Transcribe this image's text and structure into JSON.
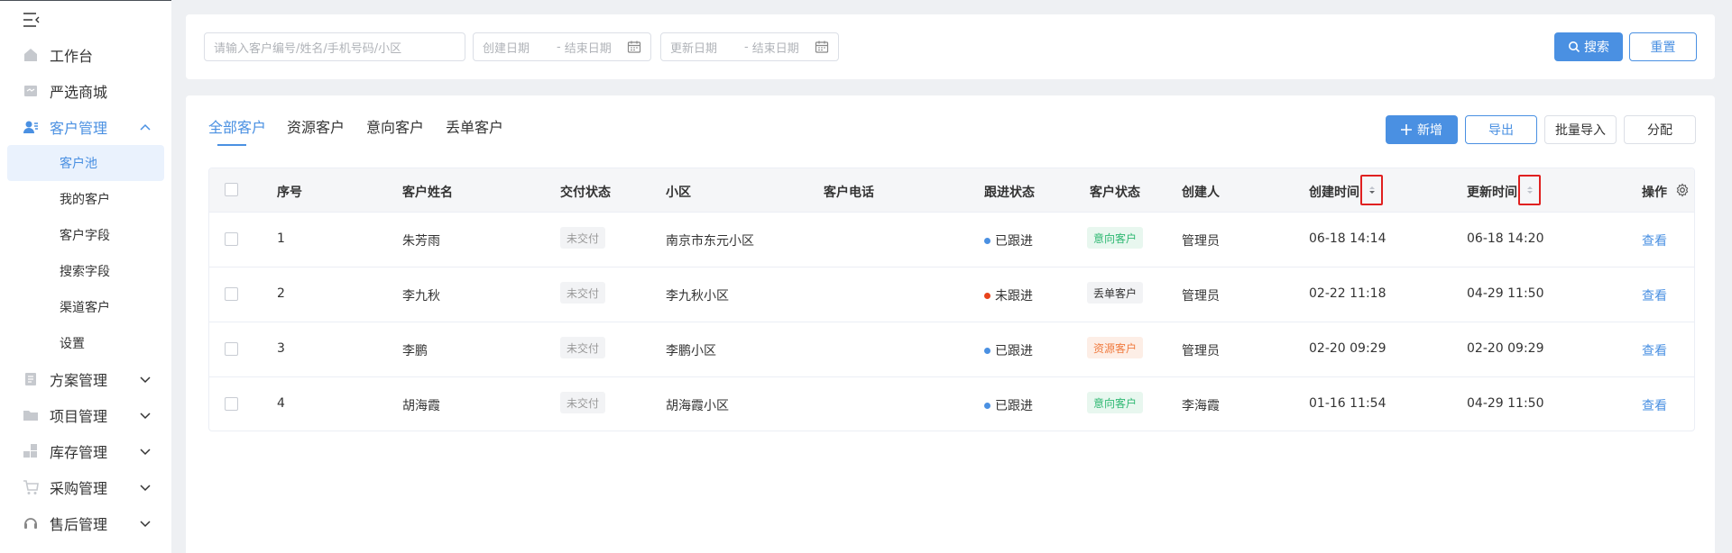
{
  "sidebar": {
    "items": [
      {
        "label": "工作台",
        "icon": "home-icon"
      },
      {
        "label": "严选商城",
        "icon": "shop-icon"
      },
      {
        "label": "客户管理",
        "icon": "user-icon",
        "expanded": true
      },
      {
        "label": "方案管理",
        "icon": "document-icon"
      },
      {
        "label": "项目管理",
        "icon": "folder-icon"
      },
      {
        "label": "库存管理",
        "icon": "blocks-icon"
      },
      {
        "label": "采购管理",
        "icon": "cart-icon"
      },
      {
        "label": "售后管理",
        "icon": "headset-icon"
      }
    ],
    "sub_items": [
      {
        "label": "客户池",
        "active": true
      },
      {
        "label": "我的客户"
      },
      {
        "label": "客户字段"
      },
      {
        "label": "搜索字段"
      },
      {
        "label": "渠道客户"
      },
      {
        "label": "设置"
      }
    ]
  },
  "filters": {
    "search_placeholder": "请输入客户编号/姓名/手机号码/小区",
    "created": {
      "start": "创建日期",
      "sep": "-",
      "end": "结束日期"
    },
    "updated": {
      "start": "更新日期",
      "sep": "-",
      "end": "结束日期"
    },
    "search_label": "搜索",
    "reset_label": "重置"
  },
  "tabs": [
    "全部客户",
    "资源客户",
    "意向客户",
    "丢单客户"
  ],
  "actions": {
    "add_label": "新增",
    "export_label": "导出",
    "import_label": "批量导入",
    "assign_label": "分配"
  },
  "table": {
    "headers": {
      "index": "序号",
      "name": "客户姓名",
      "delivery": "交付状态",
      "community": "小区",
      "phone": "客户电话",
      "follow": "跟进状态",
      "status": "客户状态",
      "creator": "创建人",
      "created": "创建时间",
      "updated": "更新时间",
      "action": "操作"
    },
    "rows": [
      {
        "index": "1",
        "name": "朱芳雨",
        "delivery": "未交付",
        "community": "南京市东元小区",
        "phone": "",
        "follow": "已跟进",
        "follow_color": "#4a90e2",
        "status": "意向客户",
        "status_style": "green",
        "creator": "管理员",
        "created": "06-18 14:14",
        "updated": "06-18 14:20",
        "action": "查看"
      },
      {
        "index": "2",
        "name": "李九秋",
        "delivery": "未交付",
        "community": "李九秋小区",
        "phone": "",
        "follow": "未跟进",
        "follow_color": "#e8431c",
        "status": "丢单客户",
        "status_style": "plain",
        "creator": "管理员",
        "created": "02-22 11:18",
        "updated": "04-29 11:50",
        "action": "查看"
      },
      {
        "index": "3",
        "name": "李鹏",
        "delivery": "未交付",
        "community": "李鹏小区",
        "phone": "",
        "follow": "已跟进",
        "follow_color": "#4a90e2",
        "status": "资源客户",
        "status_style": "orange",
        "creator": "管理员",
        "created": "02-20 09:29",
        "updated": "02-20 09:29",
        "action": "查看"
      },
      {
        "index": "4",
        "name": "胡海霞",
        "delivery": "未交付",
        "community": "胡海霞小区",
        "phone": "",
        "follow": "已跟进",
        "follow_color": "#4a90e2",
        "status": "意向客户",
        "status_style": "green",
        "creator": "李海霞",
        "created": "01-16 11:54",
        "updated": "04-29 11:50",
        "action": "查看"
      }
    ]
  },
  "colors": {
    "accent": "#4a90e2",
    "highlight": "#e02020"
  }
}
